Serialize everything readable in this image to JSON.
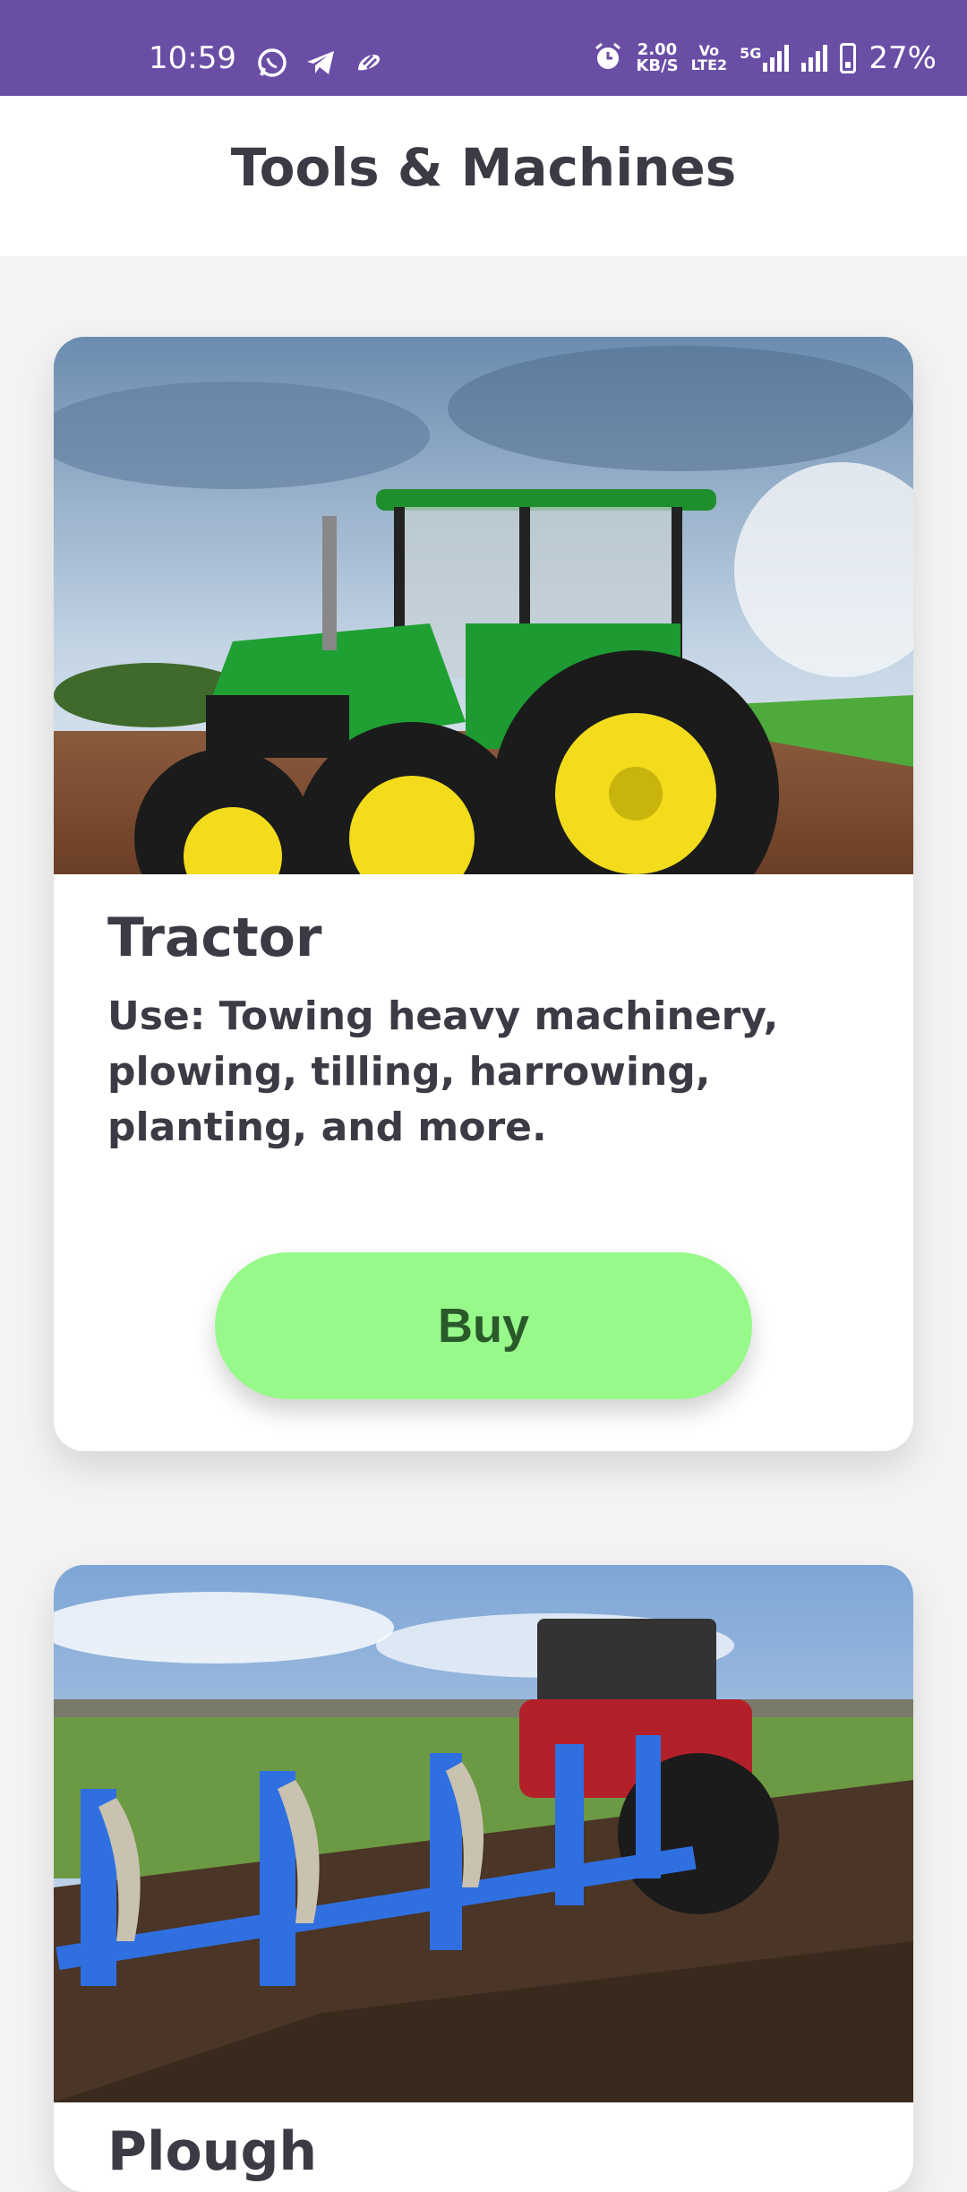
{
  "status_bar": {
    "time": "10:59",
    "speed_value": "2.00",
    "speed_unit": "KB/S",
    "volte": "Vo",
    "volte_sub": "LTE2",
    "network": "5G",
    "battery": "27%",
    "icons": [
      "whatsapp-icon",
      "telegram-icon",
      "app-icon",
      "alarm-icon",
      "signal-icon",
      "battery-icon"
    ]
  },
  "header": {
    "title": "Tools & Machines"
  },
  "cards": [
    {
      "title": "Tractor",
      "description": "Use: Towing heavy machinery, plowing, tilling, harrowing, planting, and more.",
      "button_label": "Buy",
      "image_subject": "green tractor in field"
    },
    {
      "title": "Plough",
      "image_subject": "blue plough pulled by red tractor"
    }
  ],
  "colors": {
    "status_bar_bg": "#6a4ea6",
    "button_bg": "#97f98a",
    "button_text": "#2a5a2a",
    "text": "#3d3a45"
  }
}
